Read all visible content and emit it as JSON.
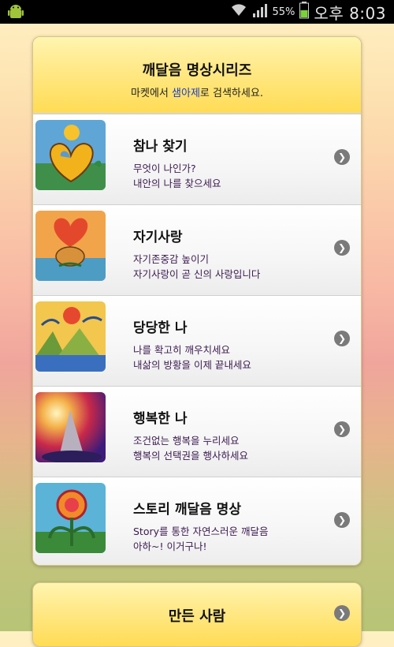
{
  "status_bar": {
    "battery_percent": "55%",
    "time": "오후 8:03",
    "icons": [
      "android-icon",
      "wifi-icon",
      "signal-icon",
      "battery-icon"
    ]
  },
  "header": {
    "title": "깨달음 명상시리즈",
    "subtitle_before": "마켓에서 ",
    "subtitle_highlight": "샘아제",
    "subtitle_after": "로 검색하세요.",
    "highlight_color": "#1a3cc8"
  },
  "items": [
    {
      "title": "참나 찾기",
      "line1": "무엇이 나인가?",
      "line2": "내안의 나를 찾으세요"
    },
    {
      "title": "자기사랑",
      "line1": "자기존중감 높이기",
      "line2": "자기사랑이 곧 신의 사랑입니다"
    },
    {
      "title": "당당한 나",
      "line1": "나를 확고히 깨우치세요",
      "line2": "내삶의 방황을 이제 끝내세요"
    },
    {
      "title": "행복한 나",
      "line1": "조건없는 행복을 누리세요",
      "line2": "행복의 선택권을 행사하세요"
    },
    {
      "title": "스토리 깨달음 명상",
      "line1": "Story를 통한 자연스러운 깨달음",
      "line2": "아하~! 이거구나!"
    }
  ],
  "footer_card": {
    "title": "만든 사람"
  },
  "colors": {
    "accent_yellow": "#ffdc55",
    "item_text": "#3b1a50"
  }
}
